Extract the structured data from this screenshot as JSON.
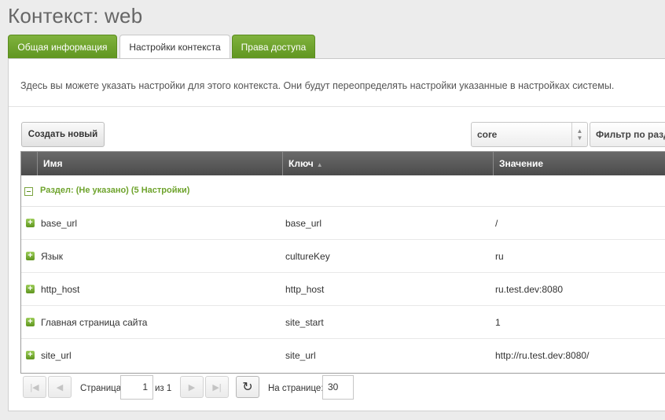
{
  "page": {
    "title": "Контекст: web"
  },
  "tabs": [
    {
      "label": "Общая информация",
      "state": "inactive"
    },
    {
      "label": "Настройки контекста",
      "state": "active"
    },
    {
      "label": "Права доступа",
      "state": "inactive"
    }
  ],
  "description": "Здесь вы можете указать настройки для этого контекста. Они будут переопределять настройки указанные в настройках системы.",
  "toolbar": {
    "create_label": "Создать новый",
    "namespace_value": "core",
    "filter_label": "Фильтр по разделу..."
  },
  "grid": {
    "columns": [
      "Имя",
      "Ключ",
      "Значение"
    ],
    "group_label": "Раздел: (Не указано) (5 Настройки)",
    "rows": [
      {
        "name": "base_url",
        "key": "base_url",
        "value": "/"
      },
      {
        "name": "Язык",
        "key": "cultureKey",
        "value": "ru"
      },
      {
        "name": "http_host",
        "key": "http_host",
        "value": "ru.test.dev:8080"
      },
      {
        "name": "Главная страница сайта",
        "key": "site_start",
        "value": "1"
      },
      {
        "name": "site_url",
        "key": "site_url",
        "value": "http://ru.test.dev:8080/"
      }
    ]
  },
  "pager": {
    "page_label": "Страница",
    "page_value": "1",
    "of_label": "из 1",
    "per_page_label": "На странице:",
    "per_page_value": "30"
  },
  "colors": {
    "accent": "#6ea32c",
    "header_bg": "#555555"
  }
}
